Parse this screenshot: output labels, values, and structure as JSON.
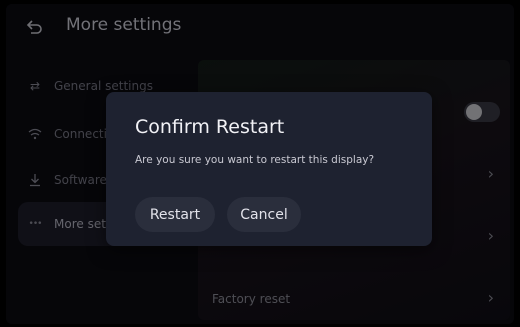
{
  "header": {
    "title": "More settings",
    "back_icon": "back-arrow-icon"
  },
  "sidebar": {
    "items": [
      {
        "label": "General settings",
        "icon": "sliders-icon",
        "glyph": "⇄",
        "active": false
      },
      {
        "label": "Connecti",
        "icon": "wifi-icon",
        "glyph": "◠",
        "active": false
      },
      {
        "label": "Software",
        "icon": "download-icon",
        "glyph": "⤓",
        "active": false
      },
      {
        "label": "More sett",
        "icon": "more-dots-icon",
        "glyph": "•••",
        "active": true
      }
    ]
  },
  "panel": {
    "toggle_on": false,
    "rows": [
      {
        "label": "",
        "chevron": "›"
      },
      {
        "label": "",
        "chevron": "›"
      },
      {
        "label": "Factory reset",
        "chevron": "›"
      }
    ]
  },
  "dialog": {
    "title": "Confirm Restart",
    "message": "Are you sure you want to restart this display?",
    "restart_label": "Restart",
    "cancel_label": "Cancel"
  },
  "colors": {
    "background": "#0b0b12",
    "dialog": "#1e2230",
    "button": "#2a2e3c"
  }
}
